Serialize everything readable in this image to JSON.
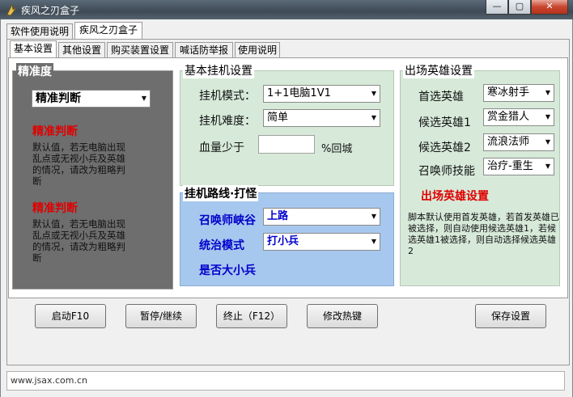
{
  "window": {
    "title": "疾风之刃盒子",
    "controls": {
      "minimize": "—",
      "maximize": "▢",
      "close": "✕"
    }
  },
  "outer_tabs": [
    {
      "label": "软件使用说明"
    },
    {
      "label": "疾风之刃盒子"
    }
  ],
  "inner_tabs": [
    {
      "label": "基本设置"
    },
    {
      "label": "其他设置"
    },
    {
      "label": "购买装置设置"
    },
    {
      "label": "喊话防举报"
    },
    {
      "label": "使用说明"
    }
  ],
  "accuracy": {
    "title": "精准度",
    "combo_value": "精准判断",
    "heading1": "精准判断",
    "desc1": "默认值，若无电脑出现乱点或无视小兵及英雄的情况，请改为粗略判断",
    "heading2": "精准判断",
    "desc2": "默认值，若无电脑出现乱点或无视小兵及英雄的情况，请改为粗略判断"
  },
  "basic": {
    "title": "基本挂机设置",
    "mode_label": "挂机模式：",
    "mode_value": "1+1电脑1V1",
    "difficulty_label": "挂机难度：",
    "difficulty_value": "简单",
    "hp_label": "血量少于",
    "hp_value": "",
    "hp_suffix": "%回城"
  },
  "route": {
    "title": "挂机路线·打怪",
    "map_label": "召唤师峡谷",
    "map_value": "上路",
    "mode_label": "统治模式",
    "mode_value": "打小兵",
    "big_minion_label": "是否大小兵"
  },
  "heroes": {
    "title": "出场英雄设置",
    "first_label": "首选英雄",
    "first_value": "寒冰射手",
    "alt1_label": "候选英雄1",
    "alt1_value": "赏金猎人",
    "alt2_label": "候选英雄2",
    "alt2_value": "流浪法师",
    "skill_label": "召唤师技能",
    "skill_value": "治疗-重生",
    "red_heading": "出场英雄设置",
    "desc": "脚本默认使用首发英雄，若首发英雄已被选择，则自动使用候选英雄1，若候选英雄1被选择，则自动选择候选英雄2"
  },
  "buttons": {
    "start": "启动F10",
    "pause": "暂停/继续",
    "stop": "终止（F12）",
    "hotkey": "修改热键",
    "save": "保存设置"
  },
  "status": {
    "url": "www.jsax.com.cn"
  },
  "colors": {
    "title_bar": "#4a5866",
    "gray_panel": "#6e6e6e",
    "green_panel": "#d7ead9",
    "blue_panel": "#a7c8ee",
    "red_text": "#e00000",
    "blue_text": "#0000cc"
  }
}
